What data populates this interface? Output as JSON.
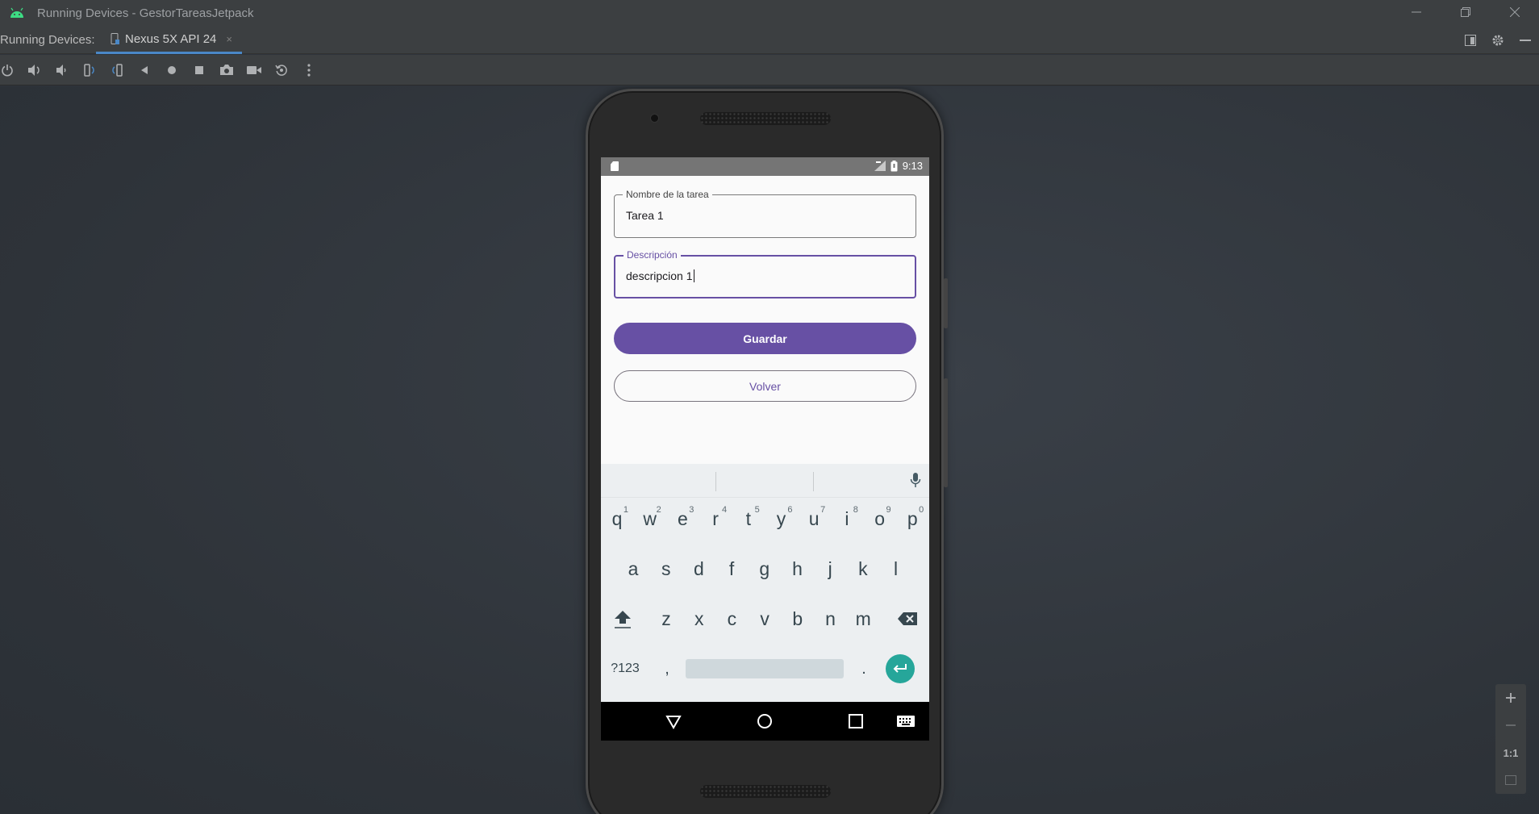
{
  "window": {
    "title": "Running Devices - GestorTareasJetpack",
    "controls": [
      "minimize-icon",
      "restore-icon",
      "close-icon"
    ]
  },
  "tabbar": {
    "label": "Running Devices:",
    "tab": {
      "label": "Nexus 5X API 24",
      "icon": "phone-icon",
      "close": "×"
    },
    "right_icons": [
      "layout-icon",
      "gear-icon",
      "minimize-icon"
    ]
  },
  "toolbar": {
    "icons": [
      "power-icon",
      "volume-up-icon",
      "volume-down-icon",
      "rotate-left-icon",
      "rotate-right-icon",
      "back-icon",
      "home-icon",
      "overview-icon",
      "screenshot-icon",
      "screen-record-icon",
      "reset-icon",
      "more-icon"
    ]
  },
  "device": {
    "statusbar": {
      "time": "9:13"
    },
    "form": {
      "name_label": "Nombre de la tarea",
      "name_value": "Tarea 1",
      "desc_label": "Descripción",
      "desc_value": "descripcion 1",
      "save_label": "Guardar",
      "back_label": "Volver"
    },
    "keyboard": {
      "row1": [
        "q",
        "w",
        "e",
        "r",
        "t",
        "y",
        "u",
        "i",
        "o",
        "p"
      ],
      "row1_hints": [
        "1",
        "2",
        "3",
        "4",
        "5",
        "6",
        "7",
        "8",
        "9",
        "0"
      ],
      "row2": [
        "a",
        "s",
        "d",
        "f",
        "g",
        "h",
        "j",
        "k",
        "l"
      ],
      "row3": [
        "z",
        "x",
        "c",
        "v",
        "b",
        "n",
        "m"
      ],
      "symbols_label": "?123",
      "comma": ",",
      "period": "."
    }
  },
  "zoom": {
    "ratio_label": "1:1"
  },
  "colors": {
    "accent": "#6750a4",
    "enter": "#26a69a",
    "ide_bg": "#3c3f41"
  }
}
